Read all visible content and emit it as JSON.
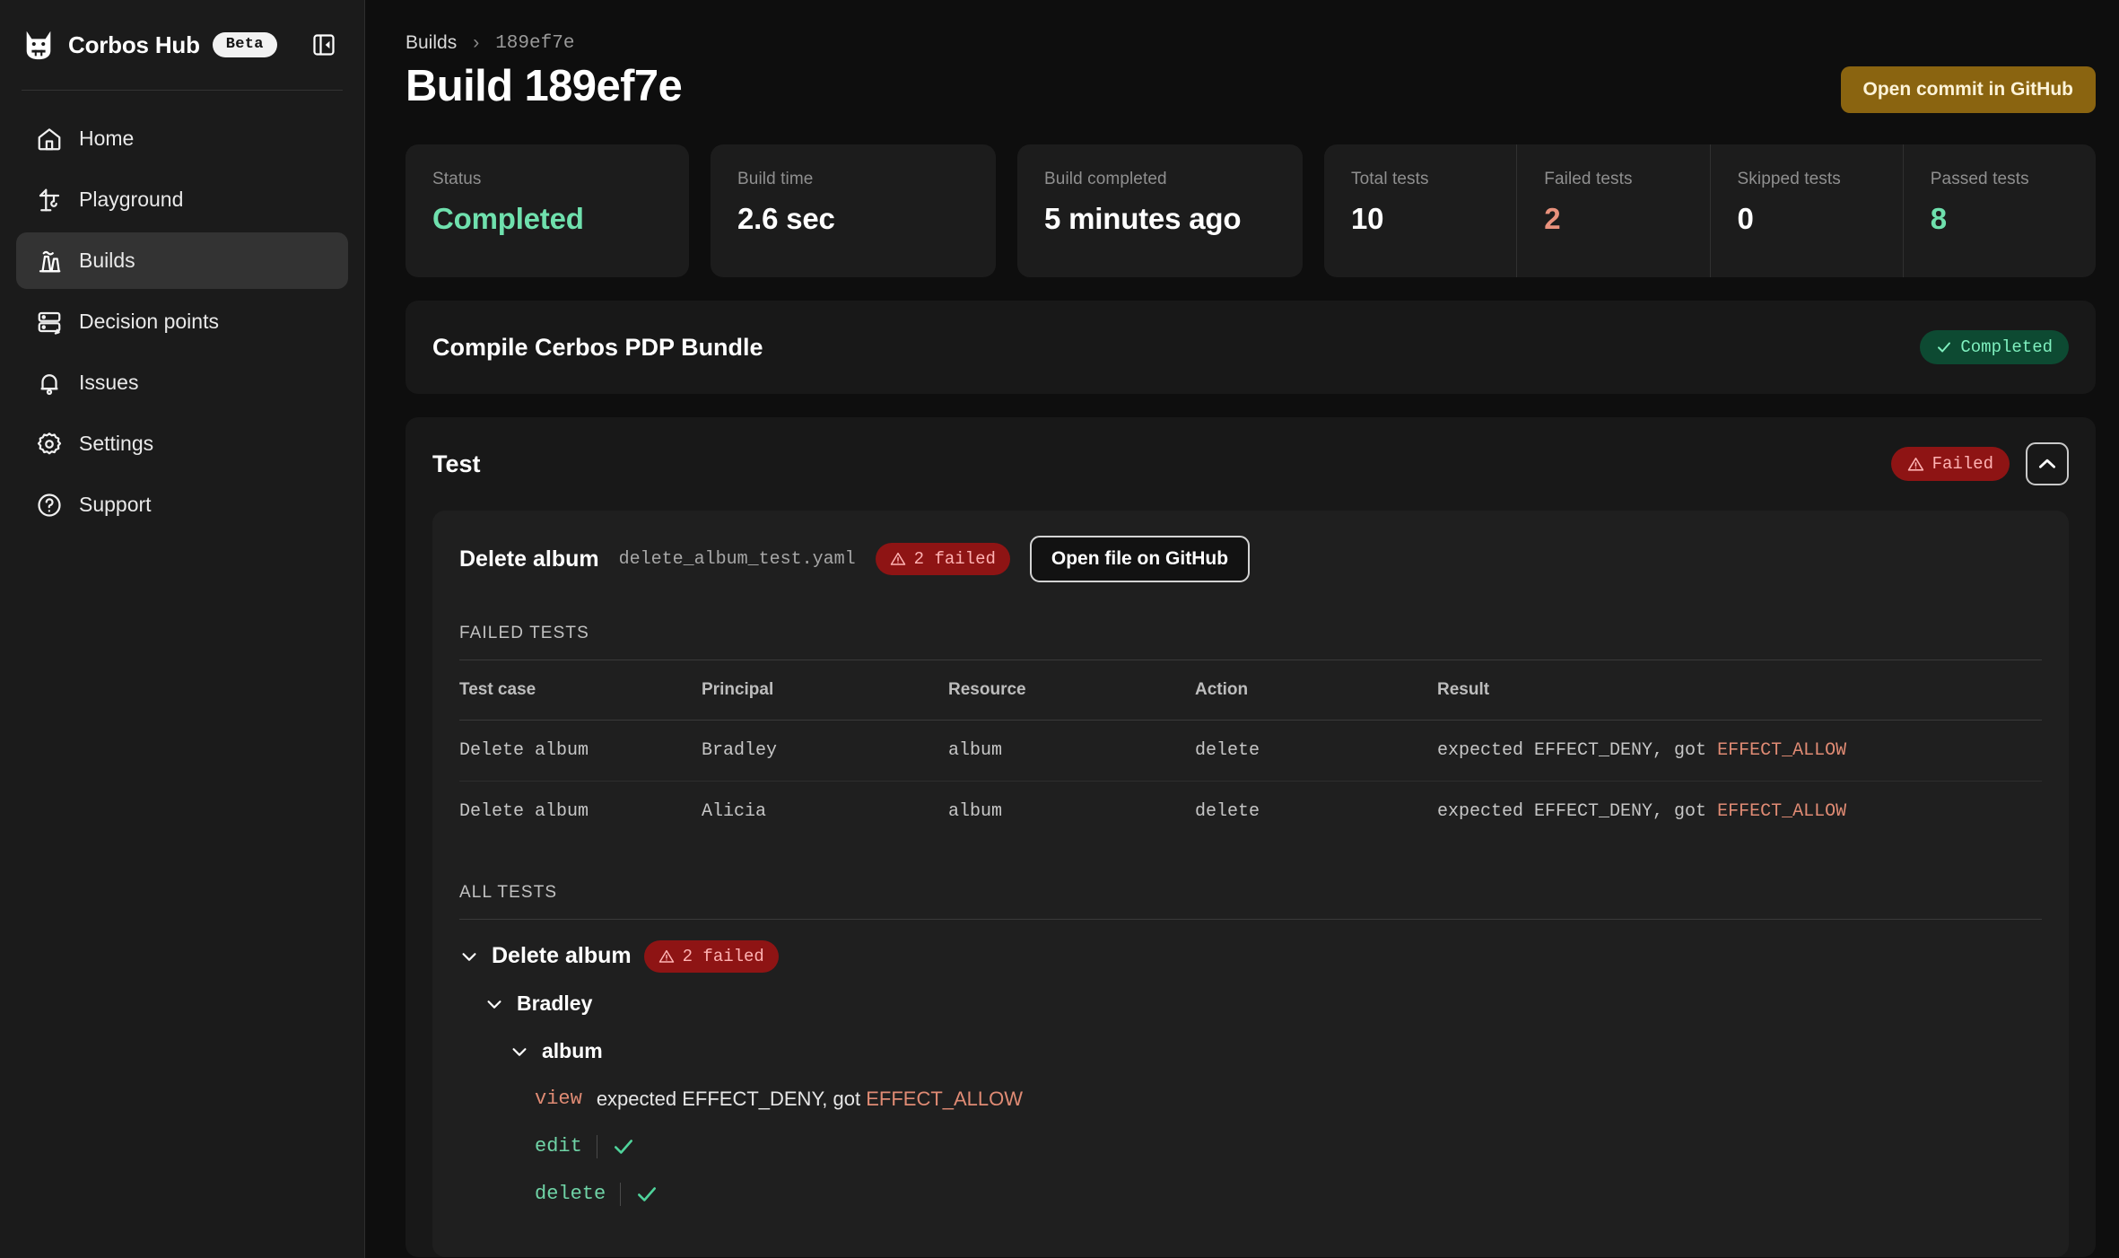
{
  "sidebar": {
    "brand": {
      "name": "Corbos Hub",
      "badge": "Beta"
    },
    "collapse_icon": "panel-collapse-icon",
    "items": [
      {
        "label": "Home",
        "icon": "home-icon",
        "active": false
      },
      {
        "label": "Playground",
        "icon": "crane-icon",
        "active": false
      },
      {
        "label": "Builds",
        "icon": "factory-icon",
        "active": true
      },
      {
        "label": "Decision points",
        "icon": "server-icon",
        "active": false
      },
      {
        "label": "Issues",
        "icon": "bell-icon",
        "active": false
      },
      {
        "label": "Settings",
        "icon": "gear-icon",
        "active": false
      },
      {
        "label": "Support",
        "icon": "question-circle-icon",
        "active": false
      }
    ]
  },
  "header": {
    "breadcrumb": {
      "root": "Builds",
      "separator": "›",
      "current": "189ef7e"
    },
    "title": "Build 189ef7e",
    "github_button": "Open commit in GitHub"
  },
  "stats": [
    {
      "label": "Status",
      "value": "Completed",
      "tone": "green"
    },
    {
      "label": "Build time",
      "value": "2.6 sec",
      "tone": "plain"
    },
    {
      "label": "Build completed",
      "value": "5 minutes ago",
      "tone": "plain"
    },
    {
      "label": "Total tests",
      "value": "10",
      "tone": "plain"
    },
    {
      "label": "Failed tests",
      "value": "2",
      "tone": "red"
    },
    {
      "label": "Skipped tests",
      "value": "0",
      "tone": "plain"
    },
    {
      "label": "Passed tests",
      "value": "8",
      "tone": "green"
    }
  ],
  "compile_section": {
    "title": "Compile Cerbos PDP Bundle",
    "status_badge": "Completed",
    "status_icon": "check-icon"
  },
  "test_section": {
    "title": "Test",
    "status_badge": "Failed",
    "status_icon": "warning-triangle-icon",
    "collapse_icon": "chevron-up-icon",
    "file": {
      "name": "Delete album",
      "path": "delete_album_test.yaml",
      "failed_badge": "2 failed",
      "open_button": "Open file on GitHub"
    },
    "failed_tests": {
      "heading": "FAILED TESTS",
      "columns": [
        "Test case",
        "Principal",
        "Resource",
        "Action",
        "Result"
      ],
      "rows": [
        {
          "test_case": "Delete album",
          "principal": "Bradley",
          "resource": "album",
          "action": "delete",
          "result_prefix": "expected EFFECT_DENY, got ",
          "result_actual": "EFFECT_ALLOW"
        },
        {
          "test_case": "Delete album",
          "principal": "Alicia",
          "resource": "album",
          "action": "delete",
          "result_prefix": "expected EFFECT_DENY, got ",
          "result_actual": "EFFECT_ALLOW"
        }
      ]
    },
    "all_tests": {
      "heading": "ALL TESTS",
      "root": {
        "label": "Delete album",
        "badge": "2 failed"
      },
      "principal": "Bradley",
      "resource": "album",
      "actions": [
        {
          "name": "view",
          "status": "fail",
          "message_prefix": "expected EFFECT_DENY, got ",
          "message_actual": "EFFECT_ALLOW"
        },
        {
          "name": "edit",
          "status": "pass",
          "message_prefix": "",
          "message_actual": ""
        },
        {
          "name": "delete",
          "status": "pass",
          "message_prefix": "",
          "message_actual": ""
        }
      ]
    }
  },
  "colors": {
    "accent_gold": "#8a6410",
    "success_green": "#6fe0ad",
    "fail_red": "#8e1414",
    "fail_text": "#e08b74",
    "sidebar_bg": "#1b1b1b",
    "main_bg": "#0e0e0e"
  }
}
